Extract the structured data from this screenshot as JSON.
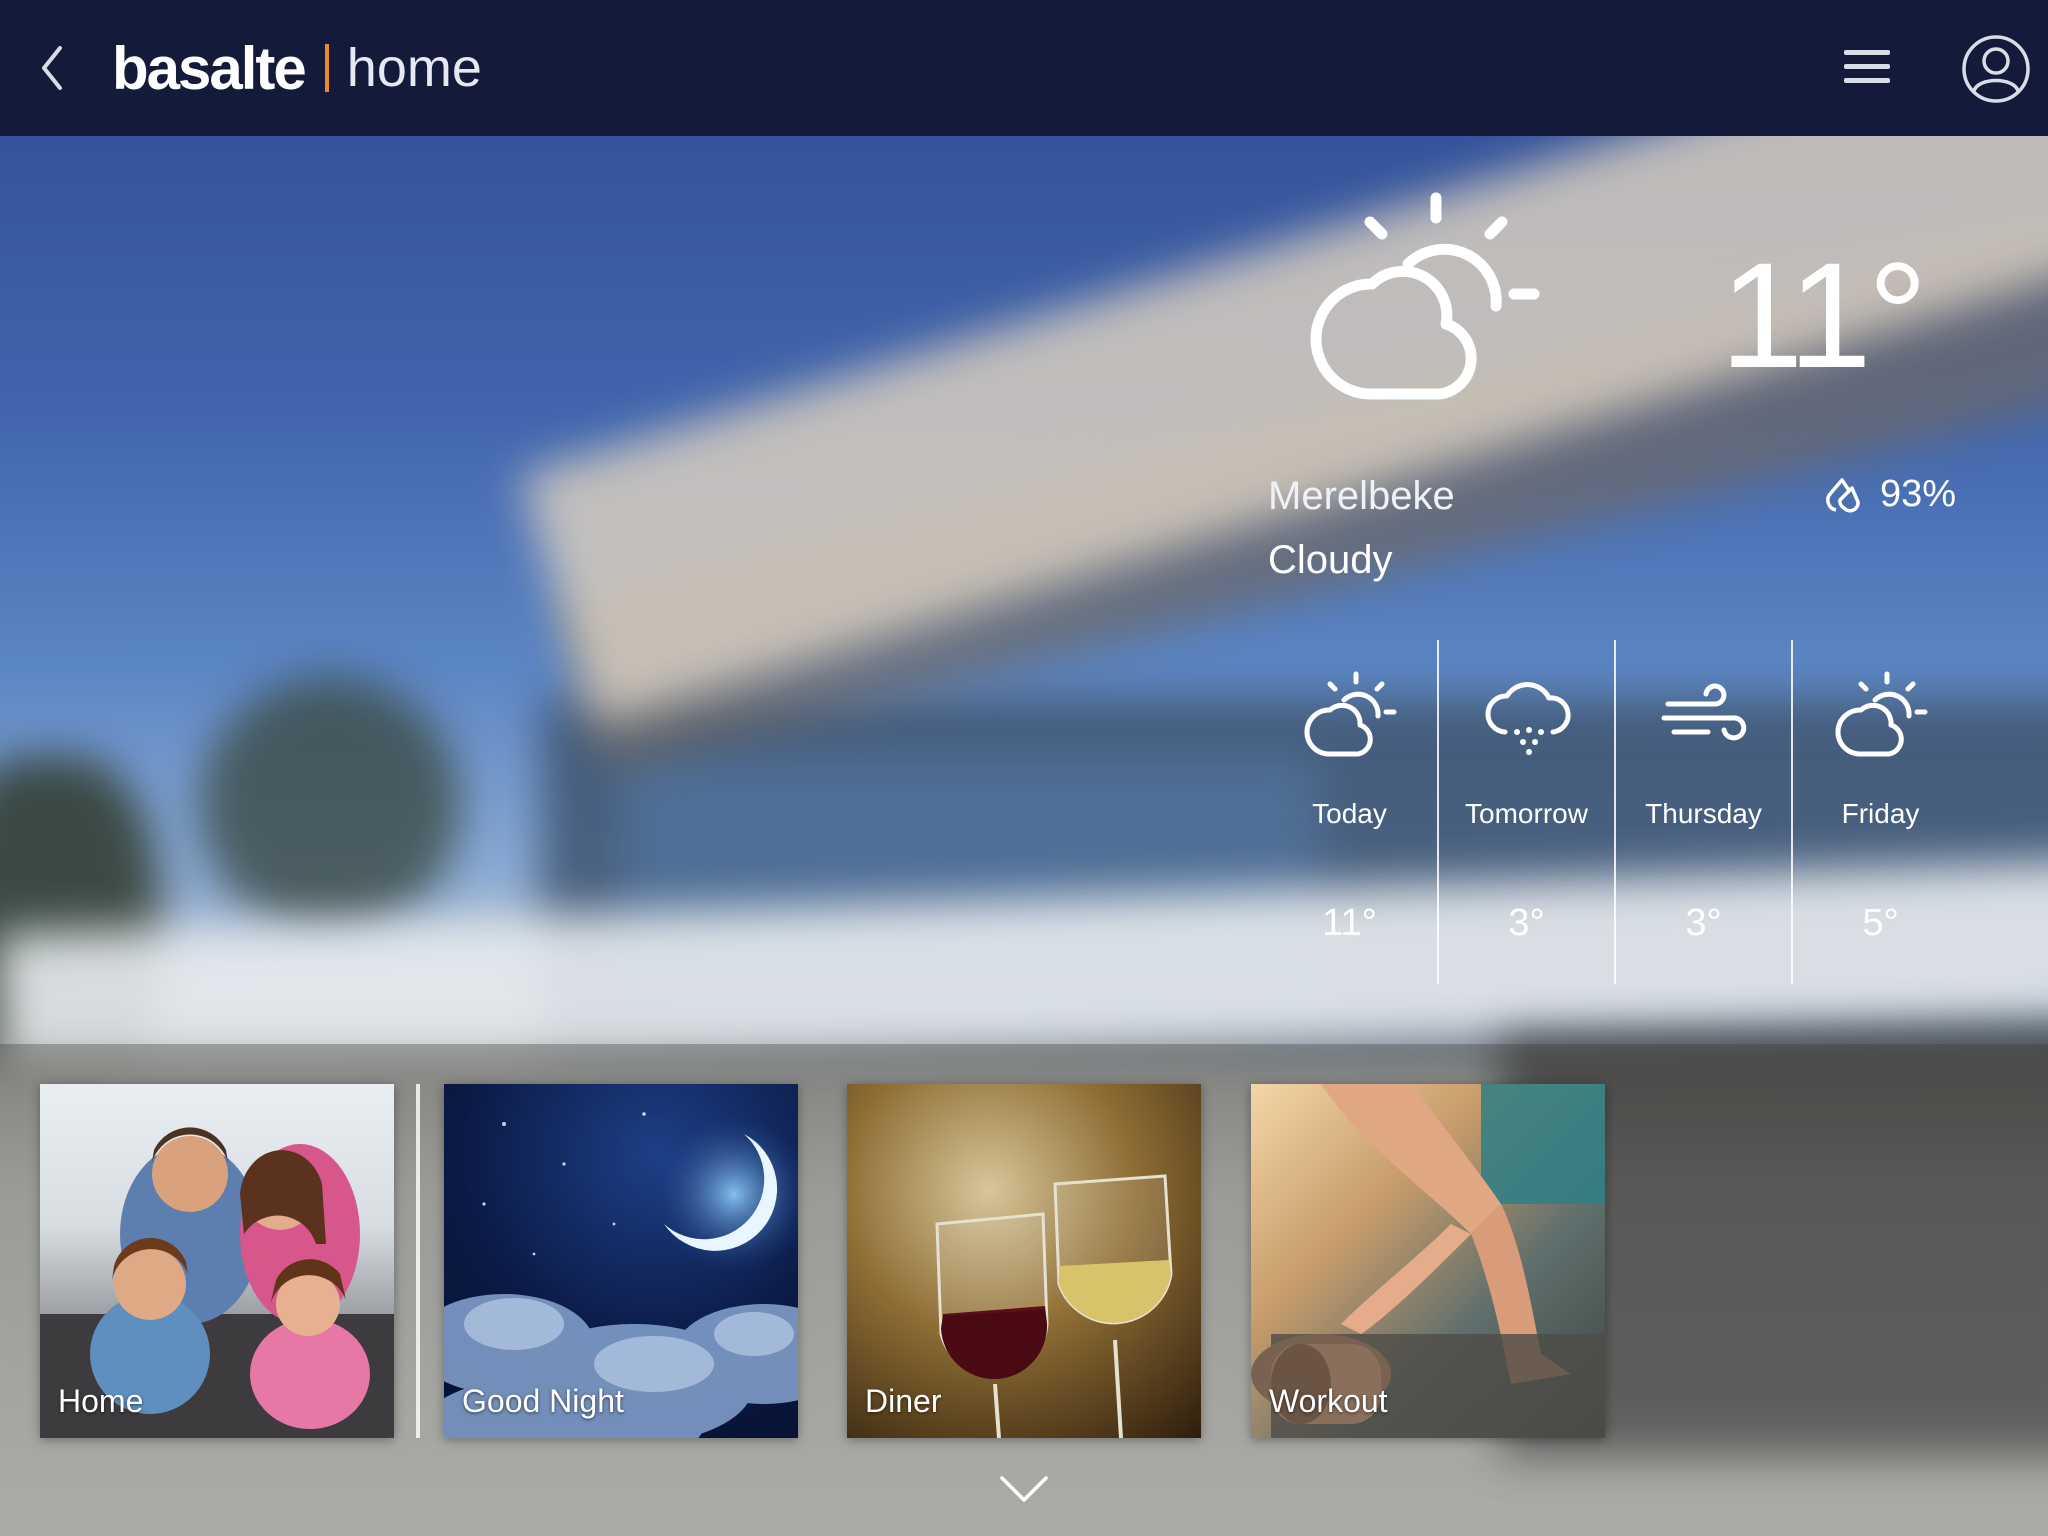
{
  "header": {
    "brand": "basalte",
    "page": "home"
  },
  "weather": {
    "current_temp": "11°",
    "location": "Merelbeke",
    "condition": "Cloudy",
    "humidity": "93%",
    "forecast": [
      {
        "day": "Today",
        "temp": "11°",
        "icon": "partly-cloudy-icon"
      },
      {
        "day": "Tomorrow",
        "temp": "3°",
        "icon": "snow-cloud-icon"
      },
      {
        "day": "Thursday",
        "temp": "3°",
        "icon": "wind-icon"
      },
      {
        "day": "Friday",
        "temp": "5°",
        "icon": "partly-cloudy-icon"
      }
    ]
  },
  "scenes": [
    {
      "label": "Home"
    },
    {
      "label": "Good Night"
    },
    {
      "label": "Diner"
    },
    {
      "label": "Workout"
    }
  ],
  "colors": {
    "topbar": "#141b3a",
    "accent": "#f08a24"
  }
}
